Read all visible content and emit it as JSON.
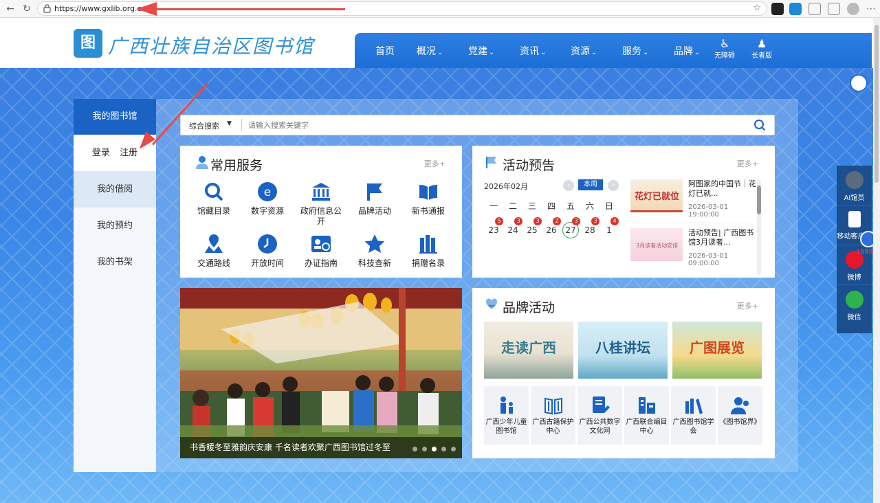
{
  "browser": {
    "url": "https://www.gxlib.org.cn"
  },
  "site": {
    "logo_text": "广西壮族自治区图书馆",
    "nav": [
      {
        "label": "首页"
      },
      {
        "label": "概况"
      },
      {
        "label": "党建"
      },
      {
        "label": "资讯"
      },
      {
        "label": "资源"
      },
      {
        "label": "服务"
      },
      {
        "label": "品牌"
      }
    ],
    "accessibility": [
      {
        "label": "无障碍"
      },
      {
        "label": "长者版"
      }
    ]
  },
  "left_menu": {
    "title": "我的图书馆",
    "login": "登录",
    "register": "注册",
    "items": [
      {
        "label": "我的借阅"
      },
      {
        "label": "我的预约"
      },
      {
        "label": "我的书架"
      }
    ]
  },
  "search": {
    "type": "综合搜索",
    "placeholder": "请输入搜索关键字"
  },
  "services": {
    "title": "常用服务",
    "more": "更多+",
    "items": [
      {
        "label": "馆藏目录",
        "icon": "search-icon"
      },
      {
        "label": "数字资源",
        "icon": "e-resource-icon"
      },
      {
        "label": "政府信息公开",
        "icon": "government-building-icon"
      },
      {
        "label": "品牌活动",
        "icon": "flag-icon"
      },
      {
        "label": "新书通报",
        "icon": "book-open-icon"
      },
      {
        "label": "交通路线",
        "icon": "map-route-icon"
      },
      {
        "label": "开放时间",
        "icon": "clock-icon"
      },
      {
        "label": "办证指南",
        "icon": "id-card-icon"
      },
      {
        "label": "科技查新",
        "icon": "star-icon"
      },
      {
        "label": "捐赠名录",
        "icon": "book-list-icon"
      }
    ]
  },
  "events": {
    "title": "活动预告",
    "more": "更多+",
    "month": "2026年02月",
    "this_week": "本周",
    "weekdays": [
      "一",
      "二",
      "三",
      "四",
      "五",
      "六",
      "日"
    ],
    "days": [
      {
        "day": "23",
        "count": "5"
      },
      {
        "day": "24",
        "count": "3"
      },
      {
        "day": "25",
        "count": "3"
      },
      {
        "day": "26",
        "count": "2"
      },
      {
        "day": "27",
        "count": "3"
      },
      {
        "day": "28",
        "count": "3"
      },
      {
        "day": "1",
        "count": "4"
      }
    ],
    "items": [
      {
        "title": "阿图家的中国节｜花灯已就...",
        "date": "2026-03-01 19:00:00",
        "thumb_text": "花灯已就位"
      },
      {
        "title": "活动预告| 广西图书馆3月读者...",
        "date": "2026-03-01 09:00:00",
        "thumb_text": "3月读者活动安排"
      }
    ]
  },
  "carousel": {
    "caption": "书香暖冬至雅韵庆安康 千名读者欢聚广西图书馆过冬至"
  },
  "brands": {
    "title": "品牌活动",
    "more": "更多+",
    "images": [
      {
        "text": "走读广西"
      },
      {
        "text": "八桂讲坛"
      },
      {
        "text": "广图展览"
      }
    ],
    "links": [
      {
        "label": "广西少年儿童图书馆"
      },
      {
        "label": "广西古籍保护中心"
      },
      {
        "label": "广西公共数字文化网"
      },
      {
        "label": "广西联合编目中心"
      },
      {
        "label": "广西图书馆学会"
      },
      {
        "label": "《图书馆界》"
      }
    ]
  },
  "float_bar": [
    {
      "label": "AI馆员"
    },
    {
      "label": "移动客户端"
    },
    {
      "label": "微博"
    },
    {
      "label": "微信"
    }
  ],
  "side_tag": "1688"
}
